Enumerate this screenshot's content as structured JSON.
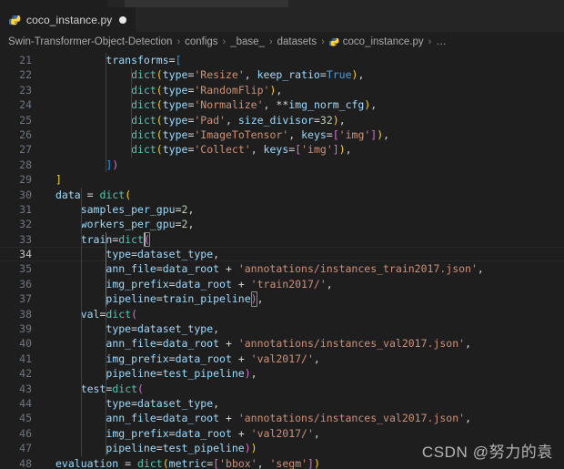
{
  "window": {
    "theme_bg": "#1e1e1e",
    "tabbar_bg": "#252526"
  },
  "tab": {
    "icon": "python-file-icon",
    "label": "coco_instance.py",
    "dirty_indicator": "unsaved-dot"
  },
  "breadcrumb": {
    "separator": "›",
    "items": [
      {
        "label": "Swin-Transformer-Object-Detection",
        "icon": null
      },
      {
        "label": "configs",
        "icon": null
      },
      {
        "label": "_base_",
        "icon": null
      },
      {
        "label": "datasets",
        "icon": null
      },
      {
        "label": "coco_instance.py",
        "icon": "python-file-icon"
      },
      {
        "label": "…",
        "icon": null
      }
    ]
  },
  "editor": {
    "active_line": 34,
    "first_line": 21,
    "last_line": 48,
    "lines": [
      {
        "n": 21,
        "tokens": [
          {
            "t": "        ",
            "c": "t-plain"
          },
          {
            "t": "transforms",
            "c": "t-var"
          },
          {
            "t": "=",
            "c": "t-op"
          },
          {
            "t": "[",
            "c": "t-b-blue"
          }
        ]
      },
      {
        "n": 22,
        "tokens": [
          {
            "t": "            ",
            "c": "t-plain"
          },
          {
            "t": "dict",
            "c": "t-fn"
          },
          {
            "t": "(",
            "c": "t-b-yellow"
          },
          {
            "t": "type",
            "c": "t-var"
          },
          {
            "t": "=",
            "c": "t-op"
          },
          {
            "t": "'Resize'",
            "c": "t-str"
          },
          {
            "t": ", ",
            "c": "t-op"
          },
          {
            "t": "keep_ratio",
            "c": "t-var"
          },
          {
            "t": "=",
            "c": "t-op"
          },
          {
            "t": "True",
            "c": "t-const"
          },
          {
            "t": ")",
            "c": "t-b-yellow"
          },
          {
            "t": ",",
            "c": "t-op"
          }
        ]
      },
      {
        "n": 23,
        "tokens": [
          {
            "t": "            ",
            "c": "t-plain"
          },
          {
            "t": "dict",
            "c": "t-fn"
          },
          {
            "t": "(",
            "c": "t-b-yellow"
          },
          {
            "t": "type",
            "c": "t-var"
          },
          {
            "t": "=",
            "c": "t-op"
          },
          {
            "t": "'RandomFlip'",
            "c": "t-str"
          },
          {
            "t": ")",
            "c": "t-b-yellow"
          },
          {
            "t": ",",
            "c": "t-op"
          }
        ]
      },
      {
        "n": 24,
        "tokens": [
          {
            "t": "            ",
            "c": "t-plain"
          },
          {
            "t": "dict",
            "c": "t-fn"
          },
          {
            "t": "(",
            "c": "t-b-yellow"
          },
          {
            "t": "type",
            "c": "t-var"
          },
          {
            "t": "=",
            "c": "t-op"
          },
          {
            "t": "'Normalize'",
            "c": "t-str"
          },
          {
            "t": ", ",
            "c": "t-op"
          },
          {
            "t": "**",
            "c": "t-op"
          },
          {
            "t": "img_norm_cfg",
            "c": "t-var"
          },
          {
            "t": ")",
            "c": "t-b-yellow"
          },
          {
            "t": ",",
            "c": "t-op"
          }
        ]
      },
      {
        "n": 25,
        "tokens": [
          {
            "t": "            ",
            "c": "t-plain"
          },
          {
            "t": "dict",
            "c": "t-fn"
          },
          {
            "t": "(",
            "c": "t-b-yellow"
          },
          {
            "t": "type",
            "c": "t-var"
          },
          {
            "t": "=",
            "c": "t-op"
          },
          {
            "t": "'Pad'",
            "c": "t-str"
          },
          {
            "t": ", ",
            "c": "t-op"
          },
          {
            "t": "size_divisor",
            "c": "t-var"
          },
          {
            "t": "=",
            "c": "t-op"
          },
          {
            "t": "32",
            "c": "t-num"
          },
          {
            "t": ")",
            "c": "t-b-yellow"
          },
          {
            "t": ",",
            "c": "t-op"
          }
        ]
      },
      {
        "n": 26,
        "tokens": [
          {
            "t": "            ",
            "c": "t-plain"
          },
          {
            "t": "dict",
            "c": "t-fn"
          },
          {
            "t": "(",
            "c": "t-b-yellow"
          },
          {
            "t": "type",
            "c": "t-var"
          },
          {
            "t": "=",
            "c": "t-op"
          },
          {
            "t": "'ImageToTensor'",
            "c": "t-str"
          },
          {
            "t": ", ",
            "c": "t-op"
          },
          {
            "t": "keys",
            "c": "t-var"
          },
          {
            "t": "=",
            "c": "t-op"
          },
          {
            "t": "[",
            "c": "t-b-pink"
          },
          {
            "t": "'img'",
            "c": "t-str"
          },
          {
            "t": "]",
            "c": "t-b-pink"
          },
          {
            "t": ")",
            "c": "t-b-yellow"
          },
          {
            "t": ",",
            "c": "t-op"
          }
        ]
      },
      {
        "n": 27,
        "tokens": [
          {
            "t": "            ",
            "c": "t-plain"
          },
          {
            "t": "dict",
            "c": "t-fn"
          },
          {
            "t": "(",
            "c": "t-b-yellow"
          },
          {
            "t": "type",
            "c": "t-var"
          },
          {
            "t": "=",
            "c": "t-op"
          },
          {
            "t": "'Collect'",
            "c": "t-str"
          },
          {
            "t": ", ",
            "c": "t-op"
          },
          {
            "t": "keys",
            "c": "t-var"
          },
          {
            "t": "=",
            "c": "t-op"
          },
          {
            "t": "[",
            "c": "t-b-pink"
          },
          {
            "t": "'img'",
            "c": "t-str"
          },
          {
            "t": "]",
            "c": "t-b-pink"
          },
          {
            "t": ")",
            "c": "t-b-yellow"
          },
          {
            "t": ",",
            "c": "t-op"
          }
        ]
      },
      {
        "n": 28,
        "tokens": [
          {
            "t": "        ",
            "c": "t-plain"
          },
          {
            "t": "]",
            "c": "t-b-blue"
          },
          {
            "t": ")",
            "c": "t-b-pink"
          }
        ]
      },
      {
        "n": 29,
        "tokens": [
          {
            "t": "",
            "c": "t-plain"
          },
          {
            "t": "]",
            "c": "t-b-yellow"
          }
        ]
      },
      {
        "n": 30,
        "tokens": [
          {
            "t": "data",
            "c": "t-var"
          },
          {
            "t": " = ",
            "c": "t-op"
          },
          {
            "t": "dict",
            "c": "t-fn"
          },
          {
            "t": "(",
            "c": "t-b-yellow"
          }
        ]
      },
      {
        "n": 31,
        "tokens": [
          {
            "t": "    ",
            "c": "t-plain"
          },
          {
            "t": "samples_per_gpu",
            "c": "t-var"
          },
          {
            "t": "=",
            "c": "t-op"
          },
          {
            "t": "2",
            "c": "t-num"
          },
          {
            "t": ",",
            "c": "t-op"
          }
        ]
      },
      {
        "n": 32,
        "tokens": [
          {
            "t": "    ",
            "c": "t-plain"
          },
          {
            "t": "workers_per_gpu",
            "c": "t-var"
          },
          {
            "t": "=",
            "c": "t-op"
          },
          {
            "t": "2",
            "c": "t-num"
          },
          {
            "t": ",",
            "c": "t-op"
          }
        ]
      },
      {
        "n": 33,
        "tokens": [
          {
            "t": "    ",
            "c": "t-plain"
          },
          {
            "t": "train",
            "c": "t-var"
          },
          {
            "t": "=",
            "c": "t-op"
          },
          {
            "t": "dict",
            "c": "t-fn"
          },
          {
            "t": "(",
            "c": "t-b-pink",
            "box": true
          }
        ]
      },
      {
        "n": 34,
        "tokens": [
          {
            "t": "        ",
            "c": "t-plain"
          },
          {
            "t": "type",
            "c": "t-var"
          },
          {
            "t": "=",
            "c": "t-op"
          },
          {
            "t": "dataset_type",
            "c": "t-var"
          },
          {
            "t": ",",
            "c": "t-op"
          }
        ]
      },
      {
        "n": 35,
        "tokens": [
          {
            "t": "        ",
            "c": "t-plain"
          },
          {
            "t": "ann_file",
            "c": "t-var"
          },
          {
            "t": "=",
            "c": "t-op"
          },
          {
            "t": "data_root",
            "c": "t-var"
          },
          {
            "t": " + ",
            "c": "t-op"
          },
          {
            "t": "'annotations/instances_train2017.json'",
            "c": "t-str"
          },
          {
            "t": ",",
            "c": "t-op"
          }
        ]
      },
      {
        "n": 36,
        "tokens": [
          {
            "t": "        ",
            "c": "t-plain"
          },
          {
            "t": "img_prefix",
            "c": "t-var"
          },
          {
            "t": "=",
            "c": "t-op"
          },
          {
            "t": "data_root",
            "c": "t-var"
          },
          {
            "t": " + ",
            "c": "t-op"
          },
          {
            "t": "'train2017/'",
            "c": "t-str"
          },
          {
            "t": ",",
            "c": "t-op"
          }
        ]
      },
      {
        "n": 37,
        "tokens": [
          {
            "t": "        ",
            "c": "t-plain"
          },
          {
            "t": "pipeline",
            "c": "t-var"
          },
          {
            "t": "=",
            "c": "t-op"
          },
          {
            "t": "train_pipeline",
            "c": "t-var"
          },
          {
            "t": ")",
            "c": "t-b-pink",
            "box": true
          },
          {
            "t": ",",
            "c": "t-op"
          }
        ]
      },
      {
        "n": 38,
        "tokens": [
          {
            "t": "    ",
            "c": "t-plain"
          },
          {
            "t": "val",
            "c": "t-var"
          },
          {
            "t": "=",
            "c": "t-op"
          },
          {
            "t": "dict",
            "c": "t-fn"
          },
          {
            "t": "(",
            "c": "t-b-pink"
          }
        ]
      },
      {
        "n": 39,
        "tokens": [
          {
            "t": "        ",
            "c": "t-plain"
          },
          {
            "t": "type",
            "c": "t-var"
          },
          {
            "t": "=",
            "c": "t-op"
          },
          {
            "t": "dataset_type",
            "c": "t-var"
          },
          {
            "t": ",",
            "c": "t-op"
          }
        ]
      },
      {
        "n": 40,
        "tokens": [
          {
            "t": "        ",
            "c": "t-plain"
          },
          {
            "t": "ann_file",
            "c": "t-var"
          },
          {
            "t": "=",
            "c": "t-op"
          },
          {
            "t": "data_root",
            "c": "t-var"
          },
          {
            "t": " + ",
            "c": "t-op"
          },
          {
            "t": "'annotations/instances_val2017.json'",
            "c": "t-str"
          },
          {
            "t": ",",
            "c": "t-op"
          }
        ]
      },
      {
        "n": 41,
        "tokens": [
          {
            "t": "        ",
            "c": "t-plain"
          },
          {
            "t": "img_prefix",
            "c": "t-var"
          },
          {
            "t": "=",
            "c": "t-op"
          },
          {
            "t": "data_root",
            "c": "t-var"
          },
          {
            "t": " + ",
            "c": "t-op"
          },
          {
            "t": "'val2017/'",
            "c": "t-str"
          },
          {
            "t": ",",
            "c": "t-op"
          }
        ]
      },
      {
        "n": 42,
        "tokens": [
          {
            "t": "        ",
            "c": "t-plain"
          },
          {
            "t": "pipeline",
            "c": "t-var"
          },
          {
            "t": "=",
            "c": "t-op"
          },
          {
            "t": "test_pipeline",
            "c": "t-var"
          },
          {
            "t": ")",
            "c": "t-b-pink"
          },
          {
            "t": ",",
            "c": "t-op"
          }
        ]
      },
      {
        "n": 43,
        "tokens": [
          {
            "t": "    ",
            "c": "t-plain"
          },
          {
            "t": "test",
            "c": "t-var"
          },
          {
            "t": "=",
            "c": "t-op"
          },
          {
            "t": "dict",
            "c": "t-fn"
          },
          {
            "t": "(",
            "c": "t-b-pink"
          }
        ]
      },
      {
        "n": 44,
        "tokens": [
          {
            "t": "        ",
            "c": "t-plain"
          },
          {
            "t": "type",
            "c": "t-var"
          },
          {
            "t": "=",
            "c": "t-op"
          },
          {
            "t": "dataset_type",
            "c": "t-var"
          },
          {
            "t": ",",
            "c": "t-op"
          }
        ]
      },
      {
        "n": 45,
        "tokens": [
          {
            "t": "        ",
            "c": "t-plain"
          },
          {
            "t": "ann_file",
            "c": "t-var"
          },
          {
            "t": "=",
            "c": "t-op"
          },
          {
            "t": "data_root",
            "c": "t-var"
          },
          {
            "t": " + ",
            "c": "t-op"
          },
          {
            "t": "'annotations/instances_val2017.json'",
            "c": "t-str"
          },
          {
            "t": ",",
            "c": "t-op"
          }
        ]
      },
      {
        "n": 46,
        "tokens": [
          {
            "t": "        ",
            "c": "t-plain"
          },
          {
            "t": "img_prefix",
            "c": "t-var"
          },
          {
            "t": "=",
            "c": "t-op"
          },
          {
            "t": "data_root",
            "c": "t-var"
          },
          {
            "t": " + ",
            "c": "t-op"
          },
          {
            "t": "'val2017/'",
            "c": "t-str"
          },
          {
            "t": ",",
            "c": "t-op"
          }
        ]
      },
      {
        "n": 47,
        "tokens": [
          {
            "t": "        ",
            "c": "t-plain"
          },
          {
            "t": "pipeline",
            "c": "t-var"
          },
          {
            "t": "=",
            "c": "t-op"
          },
          {
            "t": "test_pipeline",
            "c": "t-var"
          },
          {
            "t": ")",
            "c": "t-b-pink"
          },
          {
            "t": ")",
            "c": "t-b-yellow"
          }
        ]
      },
      {
        "n": 48,
        "tokens": [
          {
            "t": "evaluation",
            "c": "t-var"
          },
          {
            "t": " = ",
            "c": "t-op"
          },
          {
            "t": "dict",
            "c": "t-fn"
          },
          {
            "t": "(",
            "c": "t-b-yellow"
          },
          {
            "t": "metric",
            "c": "t-var"
          },
          {
            "t": "=",
            "c": "t-op"
          },
          {
            "t": "[",
            "c": "t-b-pink"
          },
          {
            "t": "'bbox'",
            "c": "t-str"
          },
          {
            "t": ", ",
            "c": "t-op"
          },
          {
            "t": "'segm'",
            "c": "t-str"
          },
          {
            "t": "]",
            "c": "t-b-pink"
          },
          {
            "t": ")",
            "c": "t-b-yellow"
          }
        ]
      }
    ]
  },
  "watermark": {
    "text": "CSDN @努力的袁"
  }
}
